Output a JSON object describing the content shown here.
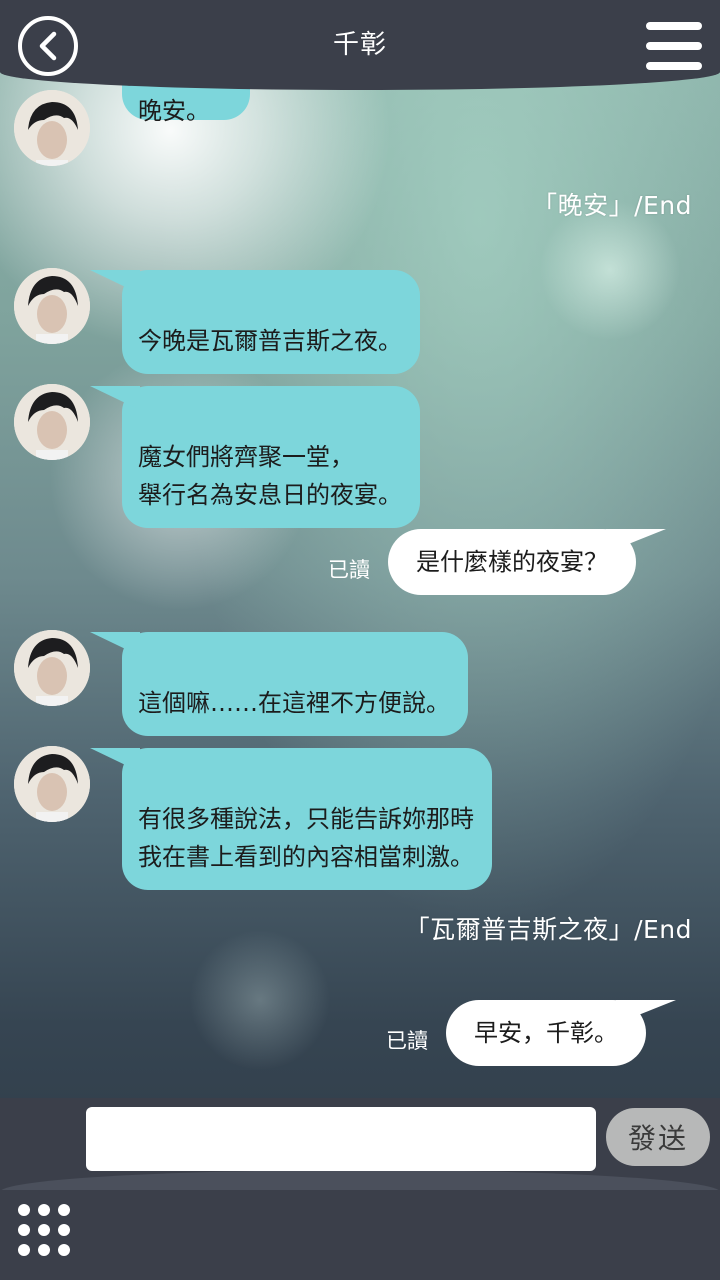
{
  "header": {
    "title": "千彰"
  },
  "chat": {
    "partial_top_message": "晚安。",
    "end_marker_1": "「晚安」/End",
    "incoming": [
      {
        "text": "今晚是瓦爾普吉斯之夜。"
      },
      {
        "text": "魔女們將齊聚一堂，\n舉行名為安息日的夜宴。"
      },
      {
        "text": "這個嘛……在這裡不方便說。"
      },
      {
        "text": "有很多種說法，只能告訴妳那時\n我在書上看到的內容相當刺激。"
      }
    ],
    "outgoing": [
      {
        "text": "是什麼樣的夜宴？",
        "read_label": "已讀"
      },
      {
        "text": "早安，千彰。",
        "read_label": "已讀"
      }
    ],
    "end_marker_2": "「瓦爾普吉斯之夜」/End"
  },
  "footer": {
    "input_value": "",
    "send_label": "發送"
  },
  "colors": {
    "header_bg": "#3b3f4a",
    "incoming_bubble": "#7dd6db",
    "outgoing_bubble": "#ffffff",
    "send_button": "#b7b8b8"
  },
  "icons": {
    "back": "back-arrow-icon",
    "menu": "hamburger-menu-icon",
    "grid": "grid-dots-icon"
  }
}
